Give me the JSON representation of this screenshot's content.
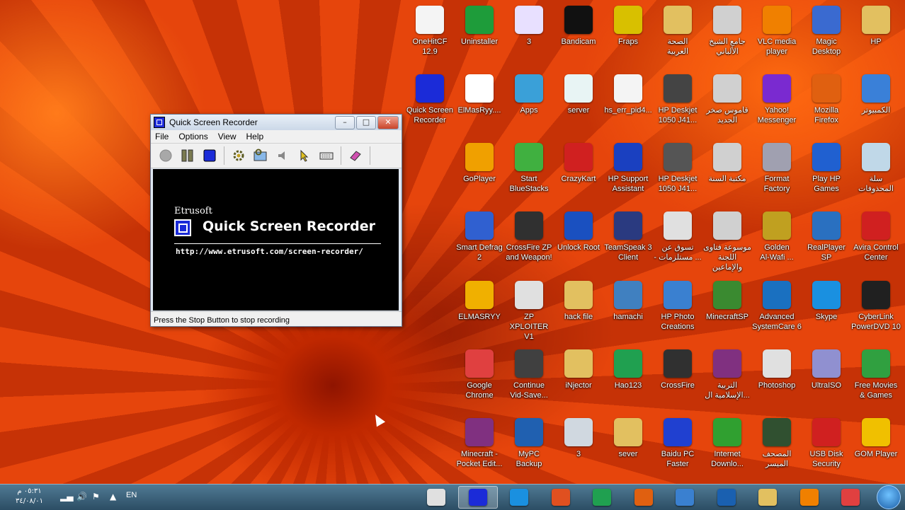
{
  "colors": {
    "taskbar": "#3b6178",
    "window_accent": "#1b2bd8",
    "close_red": "#c9442a"
  },
  "desktop_icons": [
    {
      "label": "OneHitCF\n12.9",
      "icon": "calendar-icon",
      "color": "#f4f4f4"
    },
    {
      "label": "Uninstaller",
      "icon": "uninstaller-icon",
      "color": "#1e9c3a"
    },
    {
      "label": "3",
      "icon": "flask-icon",
      "color": "#e8e0ff"
    },
    {
      "label": "Bandicam",
      "icon": "record-icon",
      "color": "#111111"
    },
    {
      "label": "Fraps",
      "icon": "fraps-icon",
      "color": "#d8c000"
    },
    {
      "label": "الصحة\nالعربية",
      "icon": "folder-icon",
      "color": "#e2c060"
    },
    {
      "label": "جامع الشيخ\nالألباني",
      "icon": "book-icon",
      "color": "#d0d0d0"
    },
    {
      "label": "VLC media\nplayer",
      "icon": "vlc-icon",
      "color": "#f08000"
    },
    {
      "label": "Magic\nDesktop",
      "icon": "magic-desktop-icon",
      "color": "#3a6ad0"
    },
    {
      "label": "HP",
      "icon": "user-folder-icon",
      "color": "#e2c060"
    },
    {
      "label": "Quick Screen\nRecorder",
      "icon": "qsr-icon",
      "color": "#1b2bd8"
    },
    {
      "label": "ElMasRyy....",
      "icon": "file-icon",
      "color": "#ffffff"
    },
    {
      "label": "Apps",
      "icon": "apps-icon",
      "color": "#3aa0d8"
    },
    {
      "label": "server",
      "icon": "file-icon",
      "color": "#e8f4f4"
    },
    {
      "label": "hs_err_pid4...",
      "icon": "text-file-icon",
      "color": "#f4f4f4"
    },
    {
      "label": "HP Deskjet\n1050 J41...",
      "icon": "scanner-icon",
      "color": "#444444"
    },
    {
      "label": "قاموس صخر\nالجديد",
      "icon": "dictionary-icon",
      "color": "#d0d0d0"
    },
    {
      "label": "Yahoo!\nMessenger",
      "icon": "yahoo-icon",
      "color": "#7a2ad0"
    },
    {
      "label": "Mozilla\nFirefox",
      "icon": "firefox-icon",
      "color": "#e06010"
    },
    {
      "label": "الكمبيوتر",
      "icon": "computer-icon",
      "color": "#3a80d8"
    },
    {
      "label": "GoPlayer",
      "icon": "goplayer-icon",
      "color": "#f0a000"
    },
    {
      "label": "Start\nBlueStacks",
      "icon": "bluestacks-icon",
      "color": "#40b040"
    },
    {
      "label": "CrazyKart",
      "icon": "crazykart-icon",
      "color": "#d02020"
    },
    {
      "label": "HP Support\nAssistant",
      "icon": "help-icon",
      "color": "#1a40c0"
    },
    {
      "label": "HP Deskjet\n1050 J41...",
      "icon": "printer-icon",
      "color": "#555555"
    },
    {
      "label": "مكتبة السنة",
      "icon": "library-icon",
      "color": "#d0d0d0"
    },
    {
      "label": "Format\nFactory",
      "icon": "format-factory-icon",
      "color": "#a0a0b0"
    },
    {
      "label": "Play HP\nGames",
      "icon": "hp-games-icon",
      "color": "#2060d0"
    },
    {
      "label": "سلة المحذوفات",
      "icon": "recycle-bin-icon",
      "color": "#c0d8e8"
    },
    {
      "label": "Smart Defrag\n2",
      "icon": "defrag-icon",
      "color": "#3060d0"
    },
    {
      "label": "CrossFire ZP\nand Weapon!",
      "icon": "crossfire-icon",
      "color": "#303030"
    },
    {
      "label": "Unlock Root",
      "icon": "unlock-root-icon",
      "color": "#1a50c0"
    },
    {
      "label": "TeamSpeak 3\nClient",
      "icon": "teamspeak-icon",
      "color": "#2a3a80"
    },
    {
      "label": "تسوق عن\n- مستلزمات ...",
      "icon": "cart-icon",
      "color": "#e0e0e0"
    },
    {
      "label": "موسوعة فتاوى\nاللجنة والإماعين",
      "icon": "book-icon",
      "color": "#d0d0d0"
    },
    {
      "label": "Golden\nAl-Wafi ...",
      "icon": "golden-icon",
      "color": "#c0a020"
    },
    {
      "label": "RealPlayer SP",
      "icon": "realplayer-icon",
      "color": "#2a70c0"
    },
    {
      "label": "Avira Control\nCenter",
      "icon": "avira-icon",
      "color": "#d02020"
    },
    {
      "label": "ELMASRYY",
      "icon": "elmasryy-icon",
      "color": "#f0b000"
    },
    {
      "label": "ZP XPLOITER\nV1",
      "icon": "window-icon",
      "color": "#e0e0e0"
    },
    {
      "label": "hack file",
      "icon": "folder-icon",
      "color": "#e2c060"
    },
    {
      "label": "hamachi",
      "icon": "hamachi-icon",
      "color": "#4080c0"
    },
    {
      "label": "HP Photo\nCreations",
      "icon": "photo-icon",
      "color": "#3a80d0"
    },
    {
      "label": "MinecraftSP",
      "icon": "minecraft-icon",
      "color": "#3a8a30"
    },
    {
      "label": "Advanced\nSystemCare 6",
      "icon": "systemcare-icon",
      "color": "#1a70c0"
    },
    {
      "label": "Skype",
      "icon": "skype-icon",
      "color": "#1a90e0"
    },
    {
      "label": "CyberLink\nPowerDVD 10",
      "icon": "powerdvd-icon",
      "color": "#202020"
    },
    {
      "label": "Google\nChrome",
      "icon": "chrome-icon",
      "color": "#e04040"
    },
    {
      "label": "Continue\nVid-Save...",
      "icon": "film-icon",
      "color": "#404040"
    },
    {
      "label": "iNjector",
      "icon": "folder-icon",
      "color": "#e2c060"
    },
    {
      "label": "Hao123",
      "icon": "hao123-icon",
      "color": "#20a050"
    },
    {
      "label": "CrossFire",
      "icon": "crossfire-icon",
      "color": "#303030"
    },
    {
      "label": "التربية\nالإسلامية ال...",
      "icon": "archive-icon",
      "color": "#803080"
    },
    {
      "label": "Photoshop",
      "icon": "photoshop-icon",
      "color": "#e0e0e0"
    },
    {
      "label": "UltraISO",
      "icon": "disc-icon",
      "color": "#9090d0"
    },
    {
      "label": "Free Movies\n& Games",
      "icon": "gift-icon",
      "color": "#30a040"
    },
    {
      "label": "Minecraft -\nPocket Edit...",
      "icon": "archive-icon",
      "color": "#803080"
    },
    {
      "label": "MyPC\nBackup",
      "icon": "backup-icon",
      "color": "#2060b0"
    },
    {
      "label": "3",
      "icon": "settings-file-icon",
      "color": "#d0d8e0"
    },
    {
      "label": "sever",
      "icon": "folder-icon",
      "color": "#e2c060"
    },
    {
      "label": "Baidu PC\nFaster",
      "icon": "baidu-icon",
      "color": "#2040d0"
    },
    {
      "label": "Internet\nDownlo...",
      "icon": "idm-icon",
      "color": "#30a030"
    },
    {
      "label": "المصحف الميسر",
      "icon": "quran-icon",
      "color": "#305030"
    },
    {
      "label": "USB Disk\nSecurity",
      "icon": "shield-icon",
      "color": "#d02020"
    },
    {
      "label": "GOM Player",
      "icon": "gom-icon",
      "color": "#f0c000"
    }
  ],
  "window": {
    "title": "Quick Screen Recorder",
    "menus": [
      "File",
      "Options",
      "View",
      "Help"
    ],
    "toolbar": [
      "record-icon",
      "pause-icon",
      "stop-icon",
      "settings-icon",
      "region-icon",
      "audio-icon",
      "cursor-icon",
      "keyboard-icon",
      "eraser-icon"
    ],
    "brand_company": "Etrusoft",
    "brand_title": "Quick Screen Recorder",
    "brand_url": "http://www.etrusoft.com/screen-recorder/",
    "status": "Press the Stop Button to stop recording"
  },
  "taskbar": {
    "time": "٠٥:٣١ م",
    "date": "٣٤/٠٨/٠١",
    "language": "EN",
    "buttons": [
      {
        "name": "explorer",
        "icon": "window-icon",
        "color": "#e0e0e0",
        "active": false
      },
      {
        "name": "quick-screen-recorder",
        "icon": "qsr-icon",
        "color": "#1b2bd8",
        "active": true
      },
      {
        "name": "skype",
        "icon": "skype-icon",
        "color": "#1a90e0",
        "active": false
      },
      {
        "name": "java",
        "icon": "java-icon",
        "color": "#e05020",
        "active": false
      },
      {
        "name": "hao123",
        "icon": "hao123-icon",
        "color": "#20a050",
        "active": false
      },
      {
        "name": "firefox",
        "icon": "firefox-icon",
        "color": "#e06010",
        "active": false
      },
      {
        "name": "hp-photo",
        "icon": "photo-icon",
        "color": "#3a80d0",
        "active": false
      },
      {
        "name": "hp",
        "icon": "hp-icon",
        "color": "#1a60b0",
        "active": false
      },
      {
        "name": "libraries",
        "icon": "folder-icon",
        "color": "#e2c060",
        "active": false
      },
      {
        "name": "media",
        "icon": "media-icon",
        "color": "#f08000",
        "active": false
      },
      {
        "name": "chrome",
        "icon": "chrome-icon",
        "color": "#e04040",
        "active": false
      }
    ]
  }
}
